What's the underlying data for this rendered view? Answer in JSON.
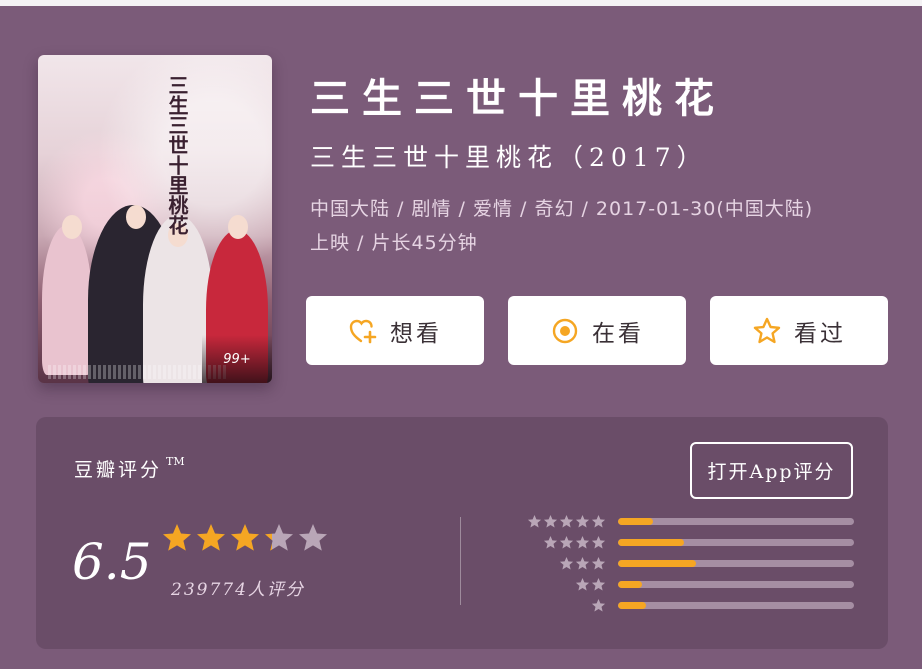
{
  "movie": {
    "title": "三生三世十里桃花",
    "subtitle": "三生三世十里桃花（2017）",
    "meta_line1": "中国大陆 / 剧情 / 爱情 / 奇幻 / 2017-01-30(中国大陆)",
    "meta_line2": "上映 / 片长45分钟",
    "poster_title": "三生三世十里桃花",
    "poster_badge": "99+"
  },
  "actions": [
    {
      "label": "想看",
      "icon": "heart-plus-icon"
    },
    {
      "label": "在看",
      "icon": "target-icon"
    },
    {
      "label": "看过",
      "icon": "star-outline-icon"
    }
  ],
  "rating": {
    "label": "豆瓣评分",
    "tm": "TM",
    "open_app_label": "打开App评分",
    "score": "6.5",
    "score_value": 6.5,
    "count_text": "239774人评分",
    "distribution": [
      {
        "stars": 5,
        "fraction": 0.15
      },
      {
        "stars": 4,
        "fraction": 0.28
      },
      {
        "stars": 3,
        "fraction": 0.33
      },
      {
        "stars": 2,
        "fraction": 0.1
      },
      {
        "stars": 1,
        "fraction": 0.12
      }
    ]
  },
  "colors": {
    "background": "#7b5b79",
    "card": "#6a4d68",
    "accent": "#f5a623",
    "track": "#a58ea3",
    "star_empty": "#b9a6b7"
  }
}
